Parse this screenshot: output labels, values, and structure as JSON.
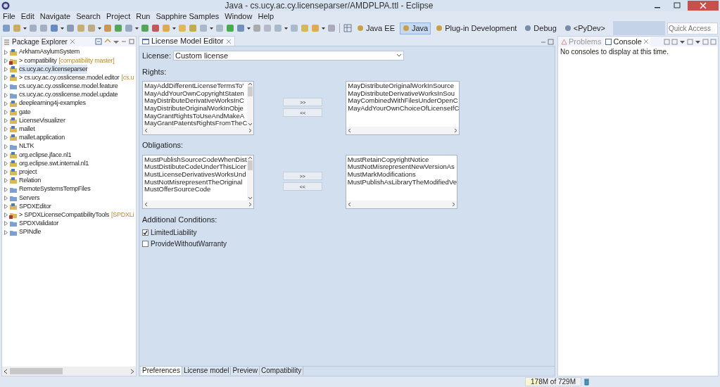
{
  "window": {
    "title": "Java - cs.ucy.ac.cy.licenseparser/AMDPLPA.ttl - Eclipse"
  },
  "menu": [
    "File",
    "Edit",
    "Navigate",
    "Search",
    "Project",
    "Run",
    "Sapphire Samples",
    "Window",
    "Help"
  ],
  "perspectives": [
    {
      "label": "Java EE",
      "selected": false
    },
    {
      "label": "Java",
      "selected": true
    },
    {
      "label": "Plug-in Development",
      "selected": false
    },
    {
      "label": "Debug",
      "selected": false
    },
    {
      "label": "<PyDev>",
      "selected": false
    }
  ],
  "quick_access": {
    "placeholder": "Quick Access"
  },
  "package_explorer": {
    "title": "Package Explorer",
    "items": [
      {
        "label": "ArkhamAsylumSystem",
        "kind": "project"
      },
      {
        "label": "compatibility",
        "kind": "repo",
        "prefix": ">",
        "decoration": "[compatibility master]"
      },
      {
        "label": "cs.ucy.ac.cy.licenseparser",
        "kind": "project",
        "selected": true
      },
      {
        "label": "cs.ucy.ac.cy.osslicense.model.editor",
        "kind": "project",
        "prefix": ">",
        "decoration": "[cs.u"
      },
      {
        "label": "cs.ucy.ac.cy.osslicense.model.feature",
        "kind": "folder"
      },
      {
        "label": "cs.ucy.ac.cy.osslicense.model.update",
        "kind": "folder"
      },
      {
        "label": "deeplearning4j-examples",
        "kind": "project"
      },
      {
        "label": "gate",
        "kind": "project"
      },
      {
        "label": "LicenseVisualizer",
        "kind": "project"
      },
      {
        "label": "mallet",
        "kind": "project"
      },
      {
        "label": "mallet.application",
        "kind": "project"
      },
      {
        "label": "NLTK",
        "kind": "folder"
      },
      {
        "label": "org.eclipse.jface.nl1",
        "kind": "project"
      },
      {
        "label": "org.eclipse.swt.internal.nl1",
        "kind": "project"
      },
      {
        "label": "project",
        "kind": "project"
      },
      {
        "label": "Relation",
        "kind": "project"
      },
      {
        "label": "RemoteSystemsTempFiles",
        "kind": "folder"
      },
      {
        "label": "Servers",
        "kind": "folder"
      },
      {
        "label": "SPDXEditor",
        "kind": "project"
      },
      {
        "label": "SPDXLicenseCompatibilityTools",
        "kind": "repo",
        "prefix": ">",
        "decoration": "[SPDXLi"
      },
      {
        "label": "SPDXValidator",
        "kind": "folder"
      },
      {
        "label": "SPINdle",
        "kind": "folder"
      }
    ]
  },
  "editor": {
    "tab": "License Model Editor",
    "license_label": "License:",
    "license_value": "Custom license",
    "sections": [
      {
        "title": "Rights:",
        "available": [
          "MayAddDifferentLicenseTermsTo'",
          "MayAddYourOwnCopyrightStaten",
          "MayDistributeDerivativeWorksInC",
          "MayDistributeOriginalWorkInObje",
          "MayGrantRightsToUseAndMakeA",
          "MayGrantPatentsRightsFromTheC"
        ],
        "chosen": [
          "MayDistributeOriginalWorkInSource",
          "MayDistributeDerivativeWorksInSou",
          "MayCombinedWithFilesUnderOpenC",
          "MayAddYourOwnChoiceOfLicenseIfC"
        ],
        "add": ">>",
        "remove": "<<"
      },
      {
        "title": "Obligations:",
        "available": [
          "MustPublishSourceCodeWhenDist",
          "MustDistibuteCodeUnderThisLicer",
          "MustLicenseDerivativesWorksUnd",
          "MustNotMisrepresentTheOriginal",
          "MustOfferSourceCode"
        ],
        "chosen": [
          "MustRetainCopyrightNotice",
          "MustNotMisrepresentNewVersionAs",
          "MustMarkModifications",
          "MustPublishAsLibraryTheModifiedVe"
        ],
        "add": ">>",
        "remove": "<<"
      }
    ],
    "conditions_title": "Additional Conditions:",
    "conditions": [
      {
        "label": "LimitedLiability",
        "checked": true
      },
      {
        "label": "ProvideWithoutWarranty",
        "checked": false
      }
    ],
    "pages": [
      {
        "label": "Preferences",
        "selected": true
      },
      {
        "label": "License model",
        "selected": false
      },
      {
        "label": "Preview",
        "selected": false
      },
      {
        "label": "Compatibility",
        "selected": false
      }
    ]
  },
  "views": {
    "tabs": [
      {
        "label": "Problems",
        "selected": false
      },
      {
        "label": "Console",
        "selected": true
      }
    ],
    "message": "No consoles to display at this time."
  },
  "status_bar": {
    "heap": "178M of 729M",
    "level": 0.24
  }
}
